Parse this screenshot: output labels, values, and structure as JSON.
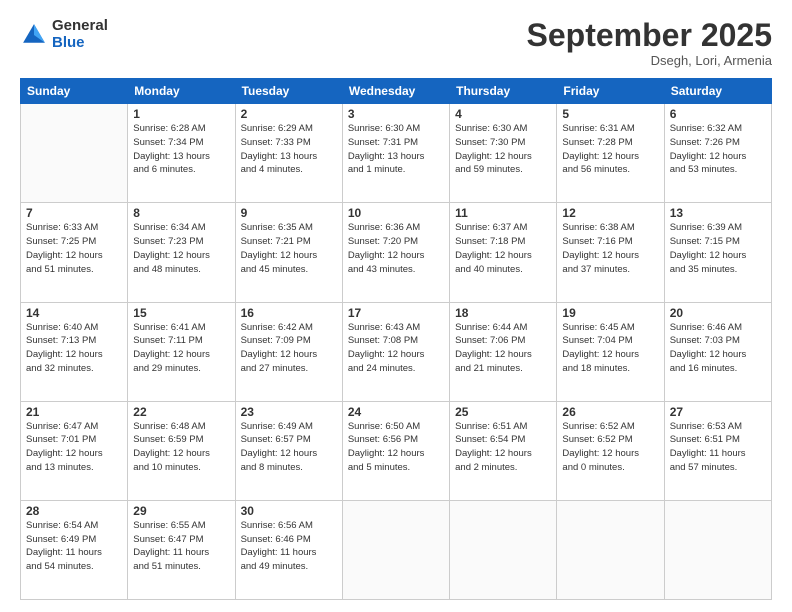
{
  "logo": {
    "general": "General",
    "blue": "Blue"
  },
  "header": {
    "month": "September 2025",
    "location": "Dsegh, Lori, Armenia"
  },
  "weekdays": [
    "Sunday",
    "Monday",
    "Tuesday",
    "Wednesday",
    "Thursday",
    "Friday",
    "Saturday"
  ],
  "weeks": [
    [
      {
        "day": "",
        "info": ""
      },
      {
        "day": "1",
        "info": "Sunrise: 6:28 AM\nSunset: 7:34 PM\nDaylight: 13 hours\nand 6 minutes."
      },
      {
        "day": "2",
        "info": "Sunrise: 6:29 AM\nSunset: 7:33 PM\nDaylight: 13 hours\nand 4 minutes."
      },
      {
        "day": "3",
        "info": "Sunrise: 6:30 AM\nSunset: 7:31 PM\nDaylight: 13 hours\nand 1 minute."
      },
      {
        "day": "4",
        "info": "Sunrise: 6:30 AM\nSunset: 7:30 PM\nDaylight: 12 hours\nand 59 minutes."
      },
      {
        "day": "5",
        "info": "Sunrise: 6:31 AM\nSunset: 7:28 PM\nDaylight: 12 hours\nand 56 minutes."
      },
      {
        "day": "6",
        "info": "Sunrise: 6:32 AM\nSunset: 7:26 PM\nDaylight: 12 hours\nand 53 minutes."
      }
    ],
    [
      {
        "day": "7",
        "info": "Sunrise: 6:33 AM\nSunset: 7:25 PM\nDaylight: 12 hours\nand 51 minutes."
      },
      {
        "day": "8",
        "info": "Sunrise: 6:34 AM\nSunset: 7:23 PM\nDaylight: 12 hours\nand 48 minutes."
      },
      {
        "day": "9",
        "info": "Sunrise: 6:35 AM\nSunset: 7:21 PM\nDaylight: 12 hours\nand 45 minutes."
      },
      {
        "day": "10",
        "info": "Sunrise: 6:36 AM\nSunset: 7:20 PM\nDaylight: 12 hours\nand 43 minutes."
      },
      {
        "day": "11",
        "info": "Sunrise: 6:37 AM\nSunset: 7:18 PM\nDaylight: 12 hours\nand 40 minutes."
      },
      {
        "day": "12",
        "info": "Sunrise: 6:38 AM\nSunset: 7:16 PM\nDaylight: 12 hours\nand 37 minutes."
      },
      {
        "day": "13",
        "info": "Sunrise: 6:39 AM\nSunset: 7:15 PM\nDaylight: 12 hours\nand 35 minutes."
      }
    ],
    [
      {
        "day": "14",
        "info": "Sunrise: 6:40 AM\nSunset: 7:13 PM\nDaylight: 12 hours\nand 32 minutes."
      },
      {
        "day": "15",
        "info": "Sunrise: 6:41 AM\nSunset: 7:11 PM\nDaylight: 12 hours\nand 29 minutes."
      },
      {
        "day": "16",
        "info": "Sunrise: 6:42 AM\nSunset: 7:09 PM\nDaylight: 12 hours\nand 27 minutes."
      },
      {
        "day": "17",
        "info": "Sunrise: 6:43 AM\nSunset: 7:08 PM\nDaylight: 12 hours\nand 24 minutes."
      },
      {
        "day": "18",
        "info": "Sunrise: 6:44 AM\nSunset: 7:06 PM\nDaylight: 12 hours\nand 21 minutes."
      },
      {
        "day": "19",
        "info": "Sunrise: 6:45 AM\nSunset: 7:04 PM\nDaylight: 12 hours\nand 18 minutes."
      },
      {
        "day": "20",
        "info": "Sunrise: 6:46 AM\nSunset: 7:03 PM\nDaylight: 12 hours\nand 16 minutes."
      }
    ],
    [
      {
        "day": "21",
        "info": "Sunrise: 6:47 AM\nSunset: 7:01 PM\nDaylight: 12 hours\nand 13 minutes."
      },
      {
        "day": "22",
        "info": "Sunrise: 6:48 AM\nSunset: 6:59 PM\nDaylight: 12 hours\nand 10 minutes."
      },
      {
        "day": "23",
        "info": "Sunrise: 6:49 AM\nSunset: 6:57 PM\nDaylight: 12 hours\nand 8 minutes."
      },
      {
        "day": "24",
        "info": "Sunrise: 6:50 AM\nSunset: 6:56 PM\nDaylight: 12 hours\nand 5 minutes."
      },
      {
        "day": "25",
        "info": "Sunrise: 6:51 AM\nSunset: 6:54 PM\nDaylight: 12 hours\nand 2 minutes."
      },
      {
        "day": "26",
        "info": "Sunrise: 6:52 AM\nSunset: 6:52 PM\nDaylight: 12 hours\nand 0 minutes."
      },
      {
        "day": "27",
        "info": "Sunrise: 6:53 AM\nSunset: 6:51 PM\nDaylight: 11 hours\nand 57 minutes."
      }
    ],
    [
      {
        "day": "28",
        "info": "Sunrise: 6:54 AM\nSunset: 6:49 PM\nDaylight: 11 hours\nand 54 minutes."
      },
      {
        "day": "29",
        "info": "Sunrise: 6:55 AM\nSunset: 6:47 PM\nDaylight: 11 hours\nand 51 minutes."
      },
      {
        "day": "30",
        "info": "Sunrise: 6:56 AM\nSunset: 6:46 PM\nDaylight: 11 hours\nand 49 minutes."
      },
      {
        "day": "",
        "info": ""
      },
      {
        "day": "",
        "info": ""
      },
      {
        "day": "",
        "info": ""
      },
      {
        "day": "",
        "info": ""
      }
    ]
  ]
}
